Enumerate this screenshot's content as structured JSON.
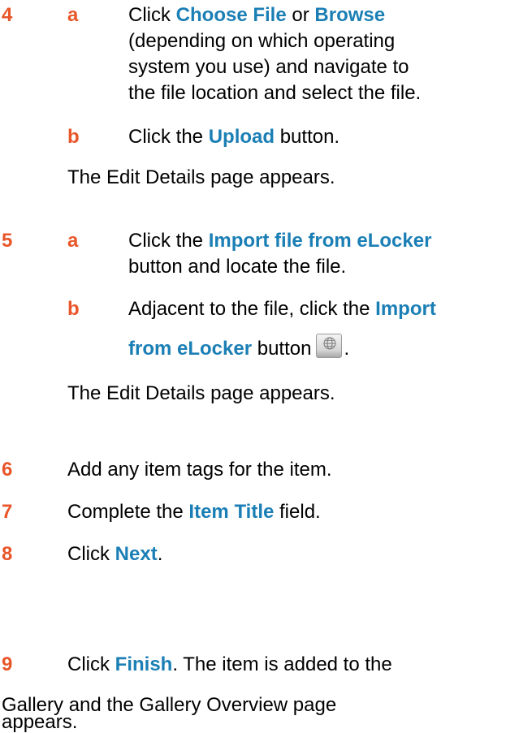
{
  "colors": {
    "step_number": "#e8562a",
    "highlight": "#1b7fb5",
    "text": "#000000"
  },
  "step4": {
    "num": "4",
    "a": {
      "letter": "a",
      "t1": "Click ",
      "h1": "Choose File",
      "t2": " or ",
      "h2": "Browse",
      "line2": "(depending on which operating",
      "line3": "system you use) and navigate to",
      "line4": "the file location and select the file."
    },
    "b": {
      "letter": "b",
      "t1": "Click the ",
      "h1": "Upload",
      "t2": " button."
    },
    "result": "The Edit Details page appears."
  },
  "step5": {
    "num": "5",
    "a": {
      "letter": "a",
      "t1": "Click the ",
      "h1": "Import file from eLocker",
      "line2": "button and locate the file."
    },
    "b": {
      "letter": "b",
      "t1": "Adjacent to the file, click the ",
      "h1": "Import",
      "h2": "from eLocker",
      "t2": " button",
      "t3": ".",
      "icon": "globe-icon"
    },
    "result": "The Edit Details page appears."
  },
  "step6": {
    "num": "6",
    "text": "Add any item tags for the item."
  },
  "step7": {
    "num": "7",
    "t1": "Complete the ",
    "h1": "Item Title",
    "t2": " field."
  },
  "step8": {
    "num": "8",
    "t1": "Click ",
    "h1": "Next",
    "t2": "."
  },
  "step9": {
    "num": "9",
    "t1": "Click ",
    "h1": "Finish",
    "t2": ". The item is added to the",
    "line2": "Gallery and the Gallery Overview page",
    "line3": "appears."
  }
}
